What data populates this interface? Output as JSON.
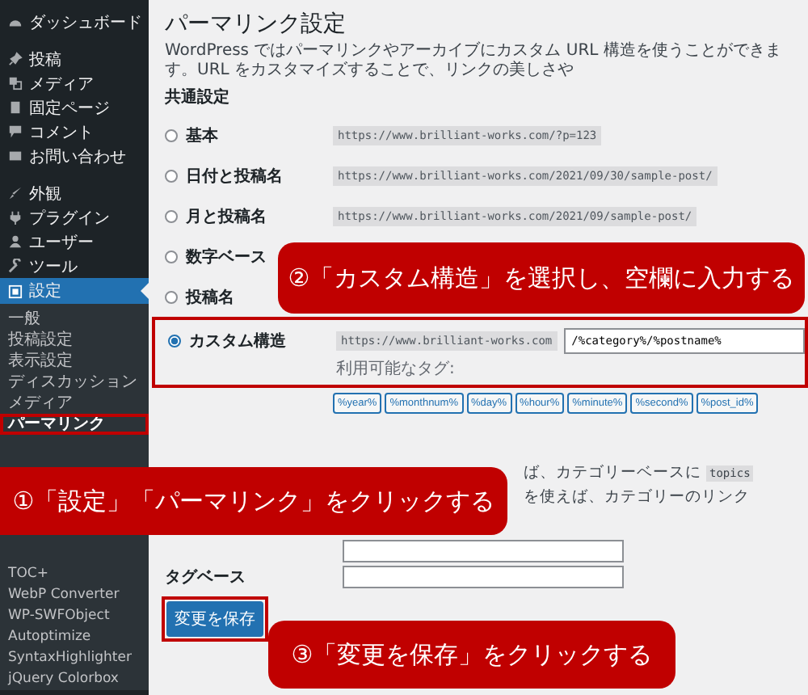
{
  "sidebar": {
    "items": [
      {
        "label": "ダッシュボード",
        "selected": false
      },
      {
        "label": "投稿",
        "selected": false
      },
      {
        "label": "メディア",
        "selected": false
      },
      {
        "label": "固定ページ",
        "selected": false
      },
      {
        "label": "コメント",
        "selected": false
      },
      {
        "label": "お問い合わせ",
        "selected": false
      },
      {
        "label": "外観",
        "selected": false
      },
      {
        "label": "プラグイン",
        "selected": false
      },
      {
        "label": "ユーザー",
        "selected": false
      },
      {
        "label": "ツール",
        "selected": false
      },
      {
        "label": "設定",
        "selected": true
      }
    ],
    "submenu": [
      {
        "label": "一般",
        "selected": false
      },
      {
        "label": "投稿設定",
        "selected": false
      },
      {
        "label": "表示設定",
        "selected": false
      },
      {
        "label": "ディスカッション",
        "selected": false
      },
      {
        "label": "メディア",
        "selected": false
      },
      {
        "label": "パーマリンク",
        "selected": true
      }
    ],
    "more_items": [
      {
        "label": "TOC+"
      },
      {
        "label": "WebP Converter"
      },
      {
        "label": "WP-SWFObject"
      },
      {
        "label": "Autoptimize"
      },
      {
        "label": "SyntaxHighlighter"
      },
      {
        "label": "jQuery Colorbox"
      }
    ]
  },
  "page": {
    "title": "パーマリンク設定",
    "description": "WordPress ではパーマリンクやアーカイブにカスタム URL 構造を使うことができます。URL をカスタマイズすることで、リンクの美しさや",
    "section_title": "共通設定",
    "options": [
      {
        "label": "基本",
        "sample": "https://www.brilliant-works.com/?p=123",
        "selected": false
      },
      {
        "label": "日付と投稿名",
        "sample": "https://www.brilliant-works.com/2021/09/30/sample-post/",
        "selected": false
      },
      {
        "label": "月と投稿名",
        "sample": "https://www.brilliant-works.com/2021/09/sample-post/",
        "selected": false
      },
      {
        "label": "数字ベース",
        "selected": false
      },
      {
        "label": "投稿名",
        "selected": false
      },
      {
        "label": "カスタム構造",
        "sample": "https://www.brilliant-works.com",
        "selected": true,
        "value": "/%category%/%postname%"
      }
    ],
    "tags_label": "利用可能なタグ:",
    "tags": [
      "%year%",
      "%monthnum%",
      "%day%",
      "%hour%",
      "%minute%",
      "%second%",
      "%post_id%"
    ],
    "optional_description": [
      "ば、カテゴリーベースに",
      "topics",
      "を使えば、カテゴリーのリンク"
    ],
    "tag_base_label": "タグベース",
    "save_button": "変更を保存"
  },
  "callouts": [
    {
      "number": "①",
      "text": "「設定」「パーマリンク」をクリックする"
    },
    {
      "number": "②",
      "text": "「カスタム構造」を選択し、空欄に入力する"
    },
    {
      "number": "③",
      "text": "「変更を保存」をクリックする"
    }
  ]
}
